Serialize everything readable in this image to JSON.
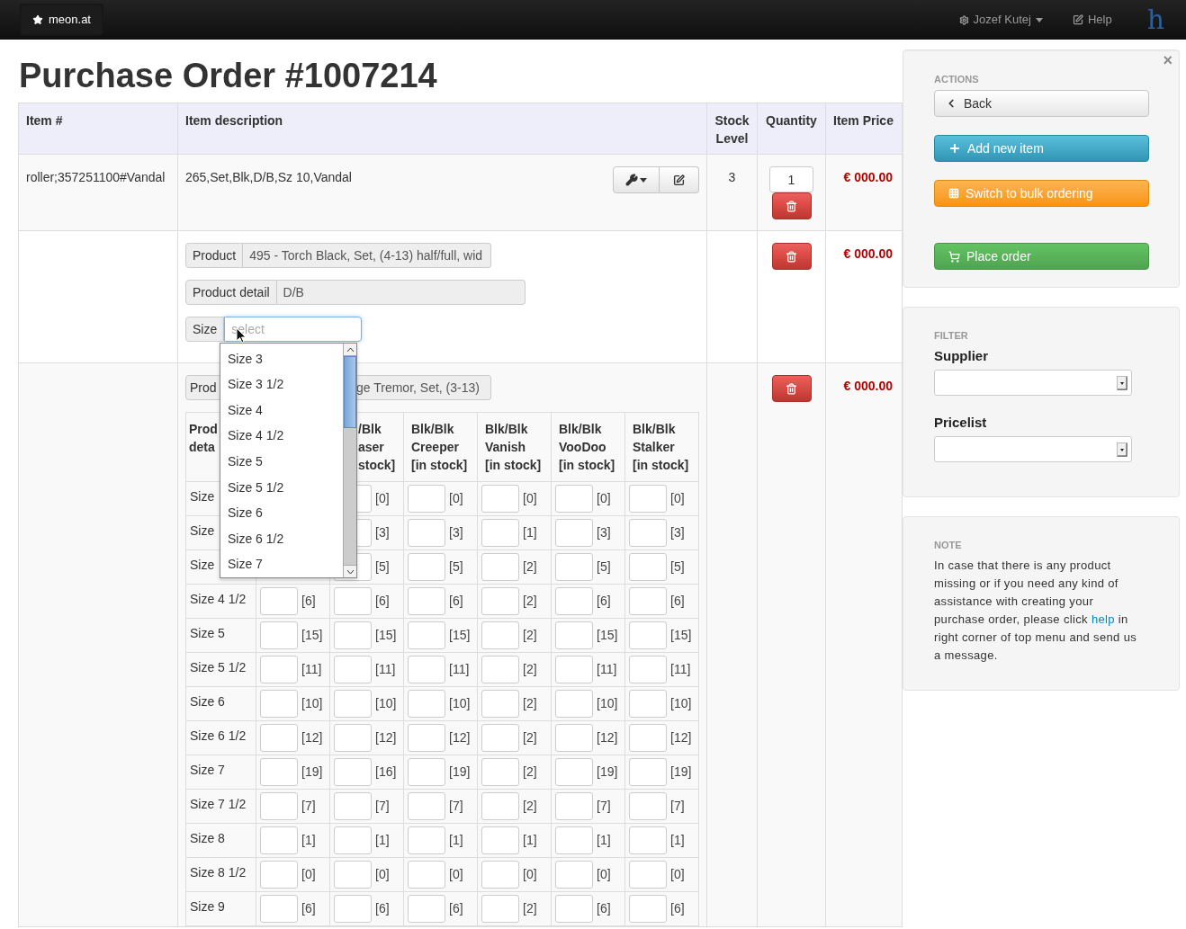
{
  "navbar": {
    "brand": "meon.at",
    "user": "Jozef Kutej",
    "help": "Help",
    "logo": "h"
  },
  "title": "Purchase Order #1007214",
  "table": {
    "columns": [
      "Item #",
      "Item description",
      "Stock Level",
      "Quantity",
      "Item Price"
    ],
    "rows": [
      {
        "kind": "item",
        "item_no": "roller;357251100#Vandal",
        "description": "265,Set,Blk,D/B,Sz 10,Vandal",
        "stock": "3",
        "quantity": "1",
        "price": "€ 000.00"
      },
      {
        "kind": "product_form",
        "product": {
          "label": "Product",
          "value": "495 - Torch Black, Set, (4-13) half/full, wid"
        },
        "product_detail": {
          "label": "Product detail",
          "value": "D/B"
        },
        "size": {
          "label": "Size",
          "placeholder": "select",
          "expanded": true,
          "options": [
            "Size 3",
            "Size 3 1/2",
            "Size 4",
            "Size 4 1/2",
            "Size 5",
            "Size 5 1/2",
            "Size 6",
            "Size 6 1/2",
            "Size 7"
          ]
        },
        "price": "€ 000.00"
      },
      {
        "kind": "bulk",
        "product": {
          "label": "Prod",
          "value": "ge Tremor, Set, (3-13)"
        },
        "grid": {
          "columns": [
            {
              "header": [
                "Prod",
                "deta"
              ]
            },
            {},
            {
              "header": [
                "/Blk",
                "aser",
                "stock]"
              ]
            },
            {
              "header": [
                "Blk/Blk",
                "Creeper",
                "[in stock]"
              ]
            },
            {
              "header": [
                "Blk/Blk",
                "Vanish",
                "[in stock]"
              ]
            },
            {
              "header": [
                "Blk/Blk",
                "VooDoo",
                "[in stock]"
              ]
            },
            {
              "header": [
                "Blk/Blk",
                "Stalker",
                "[in stock]"
              ]
            }
          ],
          "rows": [
            {
              "size": "Size",
              "values": [
                "[0]",
                "[0]",
                "[0]",
                "[0]",
                "[0]"
              ]
            },
            {
              "size": "Size",
              "values": [
                "[3]",
                "[3]",
                "[1]",
                "[3]",
                "[3]"
              ]
            },
            {
              "size": "Size",
              "values": [
                "[5]",
                "[5]",
                "[2]",
                "[5]",
                "[5]"
              ]
            },
            {
              "size": "Size 4 1/2",
              "values": [
                "[6]",
                "[6]",
                "[6]",
                "[2]",
                "[6]",
                "[6]"
              ]
            },
            {
              "size": "Size 5",
              "values": [
                "[15]",
                "[15]",
                "[15]",
                "[2]",
                "[15]",
                "[15]"
              ]
            },
            {
              "size": "Size 5 1/2",
              "values": [
                "[11]",
                "[11]",
                "[11]",
                "[2]",
                "[11]",
                "[11]"
              ]
            },
            {
              "size": "Size 6",
              "values": [
                "[10]",
                "[10]",
                "[10]",
                "[2]",
                "[10]",
                "[10]"
              ]
            },
            {
              "size": "Size 6 1/2",
              "values": [
                "[12]",
                "[12]",
                "[12]",
                "[2]",
                "[12]",
                "[12]"
              ]
            },
            {
              "size": "Size 7",
              "values": [
                "[19]",
                "[16]",
                "[19]",
                "[2]",
                "[19]",
                "[19]"
              ]
            },
            {
              "size": "Size 7 1/2",
              "values": [
                "[7]",
                "[7]",
                "[7]",
                "[2]",
                "[7]",
                "[7]"
              ]
            },
            {
              "size": "Size 8",
              "values": [
                "[1]",
                "[1]",
                "[1]",
                "[1]",
                "[1]",
                "[1]"
              ]
            },
            {
              "size": "Size 8 1/2",
              "values": [
                "[0]",
                "[0]",
                "[0]",
                "[0]",
                "[0]",
                "[0]"
              ]
            },
            {
              "size": "Size 9",
              "values": [
                "[6]",
                "[6]",
                "[6]",
                "[2]",
                "[6]",
                "[6]"
              ]
            }
          ]
        },
        "price": "€ 000.00"
      }
    ]
  },
  "sidebar": {
    "actions": {
      "heading": "ACTIONS",
      "close": "×",
      "buttons": [
        {
          "kind": "back",
          "label": "Back"
        },
        {
          "kind": "add",
          "label": "Add new item"
        },
        {
          "kind": "bulk",
          "label": "Switch to bulk ordering"
        },
        {
          "kind": "order",
          "label": "Place order"
        }
      ]
    },
    "filter": {
      "heading": "FILTER",
      "fields": [
        {
          "label": "Supplier"
        },
        {
          "label": "Pricelist"
        }
      ]
    },
    "note": {
      "heading": "NOTE",
      "text_before": "In case that there is any product missing or if you need any kind of assistance with creating your purchase order, please click ",
      "link": "help",
      "text_after": " in right corner of top menu and send us a message."
    }
  }
}
